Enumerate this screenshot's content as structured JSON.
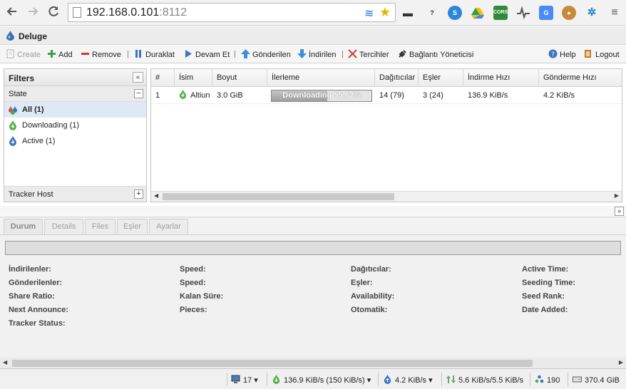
{
  "browser": {
    "url_host": "192.168.0.101",
    "url_port": ":8112"
  },
  "app": {
    "title": "Deluge"
  },
  "toolbar": {
    "create": "Create",
    "add": "Add",
    "remove": "Remove",
    "pause": "Duraklat",
    "resume": "Devam Et",
    "up": "Gönderilen",
    "down": "İndirilen",
    "preferences": "Tercihler",
    "connection_manager": "Bağlantı Yöneticisi",
    "help": "Help",
    "logout": "Logout"
  },
  "filters": {
    "title": "Filters",
    "state_title": "State",
    "items": [
      {
        "label": "All (1)"
      },
      {
        "label": "Downloading (1)"
      },
      {
        "label": "Active (1)"
      }
    ],
    "tracker_title": "Tracker Host"
  },
  "torrents": {
    "columns": [
      "#",
      "İsim",
      "Boyut",
      "İlerleme",
      "Dağıtıcılar",
      "Eşler",
      "İndirme Hızı",
      "Gönderme Hızı"
    ],
    "rows": [
      {
        "index": "1",
        "name": "Altiun",
        "size": "3.0 GiB",
        "progress_text": "Downloading 55.62%",
        "progress": 0.5562,
        "seeds": "14 (79)",
        "peers": "3 (24)",
        "down_speed": "136.9 KiB/s",
        "up_speed": "4.2 KiB/s"
      }
    ]
  },
  "details": {
    "tabs": [
      "Durum",
      "Details",
      "Files",
      "Eşler",
      "Ayarlar"
    ],
    "labels": {
      "downloaded": "İndirilenler:",
      "uploaded": "Gönderilenler:",
      "share_ratio": "Share Ratio:",
      "next_announce": "Next Announce:",
      "tracker_status": "Tracker Status:",
      "speed1": "Speed:",
      "speed2": "Speed:",
      "eta": "Kalan Süre:",
      "pieces": "Pieces:",
      "seeders": "Dağıtıcılar:",
      "peers": "Eşler:",
      "availability": "Availability:",
      "auto_managed": "Otomatik:",
      "active_time": "Active Time:",
      "seeding_time": "Seeding Time:",
      "seed_rank": "Seed Rank:",
      "date_added": "Date Added:"
    }
  },
  "statusbar": {
    "connections": "17",
    "download": "136.9 KiB/s (150 KiB/s)",
    "upload": "4.2 KiB/s",
    "traffic": "5.6 KiB/s/5.5 KiB/s",
    "dht": "190",
    "free_space": "370.4 GiB"
  }
}
